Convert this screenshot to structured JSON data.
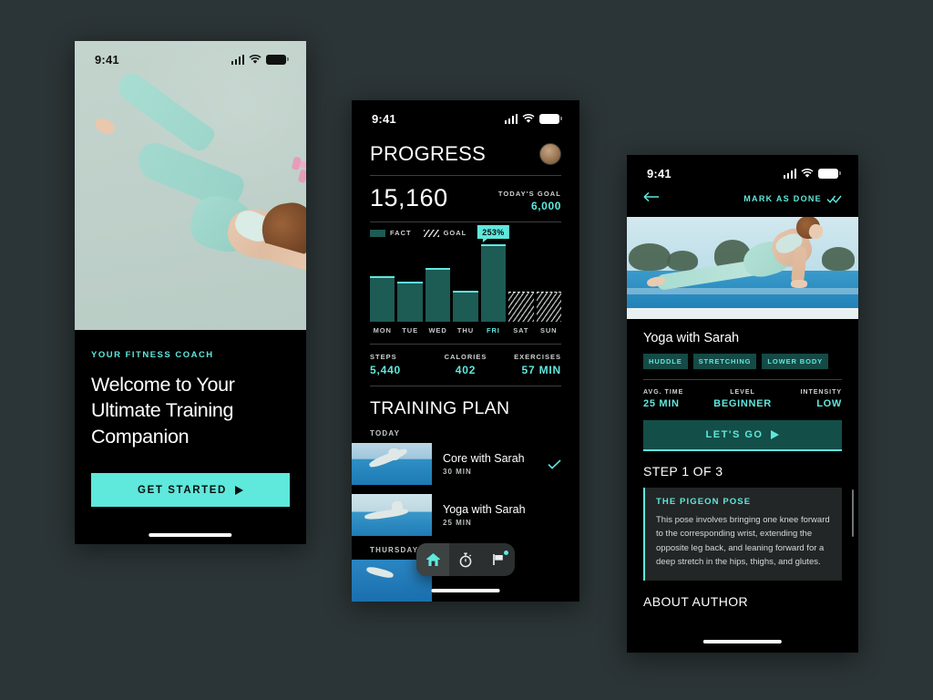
{
  "theme": {
    "page_bg": "#2b3436",
    "accent_mint": "#5fe8dc",
    "fact_teal": "#1d5b55",
    "panel_dark": "#000000"
  },
  "onboarding": {
    "status_bar": {
      "time": "9:41",
      "signal_icon": "cellular-signal-icon",
      "wifi_icon": "wifi-icon",
      "battery_icon": "battery-icon"
    },
    "hero_alt": "woman-stretching-on-mat-photo",
    "kicker": "YOUR FITNESS COACH",
    "headline": "Welcome to Your Ultimate Training Companion",
    "cta_label": "GET STARTED",
    "cta_icon": "play-triangle-icon"
  },
  "progress": {
    "status_bar": {
      "time": "9:41"
    },
    "title": "PROGRESS",
    "avatar_alt": "user-avatar",
    "steps_today": "15,160",
    "goal_label": "TODAY'S GOAL",
    "goal_value": "6,000",
    "legend": [
      {
        "key": "fact",
        "label": "FACT"
      },
      {
        "key": "goal",
        "label": "GOAL"
      }
    ],
    "stats": [
      {
        "label": "STEPS",
        "value": "5,440"
      },
      {
        "label": "CALORIES",
        "value": "402"
      },
      {
        "label": "EXERCISES",
        "value": "57 MIN"
      }
    ],
    "plan_title": "TRAINING PLAN",
    "day_groups": [
      {
        "day": "TODAY",
        "items": [
          {
            "name": "Core with Sarah",
            "duration": "30 MIN",
            "done": true,
            "check_icon": "check-icon",
            "thumb": "core-plank-thumbnail"
          },
          {
            "name": "Yoga with Sarah",
            "duration": "25 MIN",
            "done": false,
            "thumb": "yoga-pose-thumbnail"
          }
        ]
      },
      {
        "day": "THURSDAY",
        "items": []
      }
    ],
    "navbar": [
      {
        "icon": "home-icon",
        "active": true
      },
      {
        "icon": "stopwatch-icon",
        "active": false
      },
      {
        "icon": "flag-icon",
        "active": false,
        "badge": true
      }
    ]
  },
  "chart_data": {
    "type": "bar",
    "title": "Weekly step progress",
    "categories": [
      "MON",
      "TUE",
      "WED",
      "THU",
      "FRI",
      "SAT",
      "SUN"
    ],
    "series": [
      {
        "name": "FACT",
        "values": [
          148,
          131,
          176,
          99,
          253,
          0,
          0
        ]
      },
      {
        "name": "GOAL",
        "values": [
          100,
          100,
          100,
          100,
          100,
          100,
          100
        ]
      }
    ],
    "unit": "percent_of_goal",
    "goal_reference": 100,
    "highlight": {
      "category": "FRI",
      "label": "253%"
    },
    "xlabel": "",
    "ylabel": "",
    "grid": false,
    "legend_position": "top-left"
  },
  "workout": {
    "status_bar": {
      "time": "9:41"
    },
    "back_icon": "arrow-left-icon",
    "mark_done_label": "MARK AS DONE",
    "mark_done_icon": "double-check-icon",
    "hero_alt": "upward-dog-yoga-pose-photo",
    "title": "Yoga with Sarah",
    "tags": [
      "HUDDLE",
      "STRETCHING",
      "LOWER BODY"
    ],
    "meta": [
      {
        "label": "AVG. TIME",
        "value": "25 MIN"
      },
      {
        "label": "LEVEL",
        "value": "BEGINNER"
      },
      {
        "label": "INTENSITY",
        "value": "LOW"
      }
    ],
    "cta_label": "LET'S GO",
    "cta_icon": "play-triangle-icon",
    "step_title": "STEP 1 OF 3",
    "pose": {
      "name": "THE PIGEON POSE",
      "description": "This pose involves bringing one knee forward to the corresponding wrist, extending the opposite leg back, and leaning forward for a deep stretch in the hips, thighs, and glutes."
    },
    "about_title": "ABOUT AUTHOR"
  }
}
